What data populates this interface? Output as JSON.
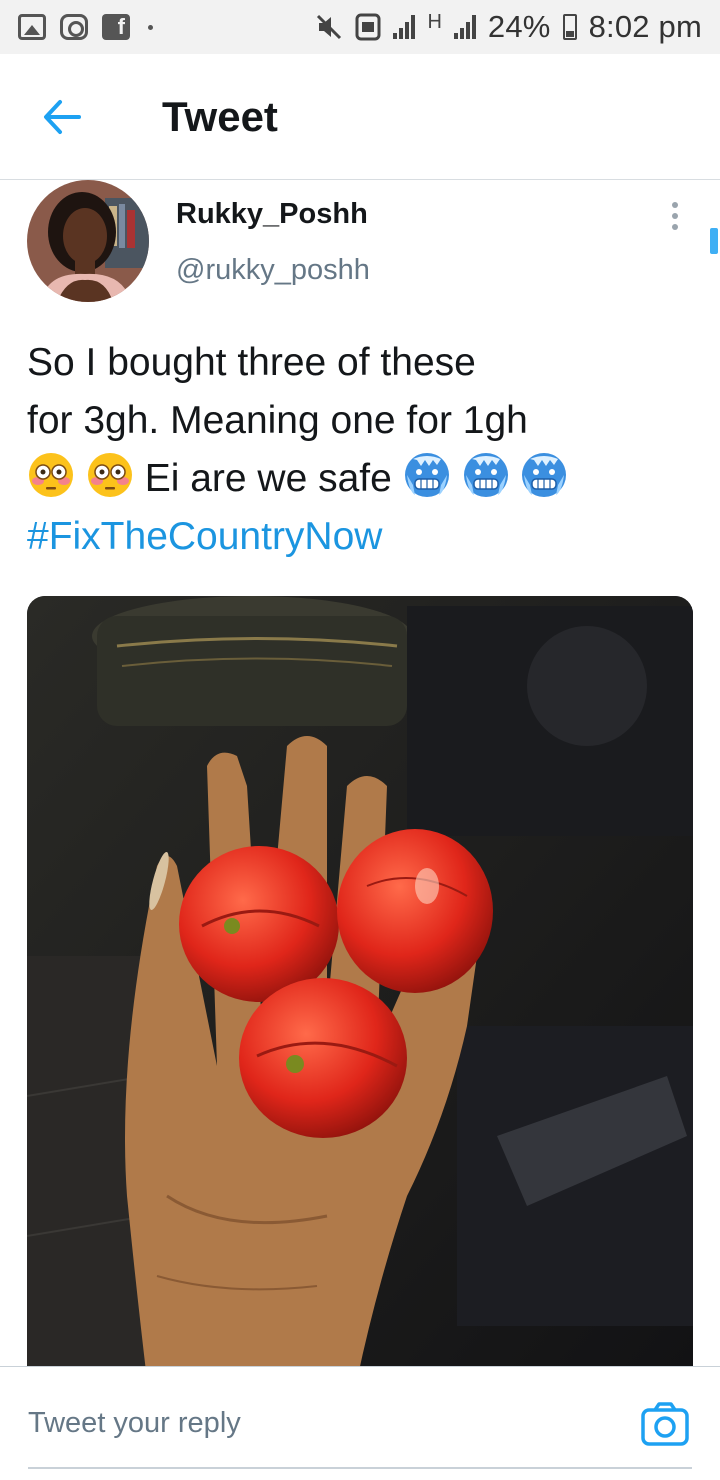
{
  "status_bar": {
    "left_icons": [
      "gallery-icon",
      "instagram-icon",
      "facebook-icon"
    ],
    "facebook_glyph": "f",
    "network_label": "H",
    "battery": "24%",
    "time": "8:02 pm"
  },
  "header": {
    "back_icon": "arrow-left-icon",
    "title": "Tweet"
  },
  "tweet": {
    "display_name": "Rukky_Poshh",
    "handle": "@rukky_poshh",
    "text_lines": [
      "So I bought three of these",
      "for 3gh. Meaning one for 1gh",
      "Ei are we safe",
      "#FixTheCountryNow"
    ],
    "emojis_before_line3": [
      "flushed-face-emoji",
      "flushed-face-emoji"
    ],
    "emojis_after_line3": [
      "cold-face-emoji",
      "cold-face-emoji",
      "cold-face-emoji"
    ],
    "media": "photo of three small tomatoes held in an open hand"
  },
  "reply": {
    "placeholder": "Tweet your reply",
    "camera_icon": "camera-icon"
  },
  "colors": {
    "accent": "#1da1f2",
    "hashtag": "#1b95e0",
    "secondary_text": "#657786",
    "primary_text": "#14171a"
  }
}
